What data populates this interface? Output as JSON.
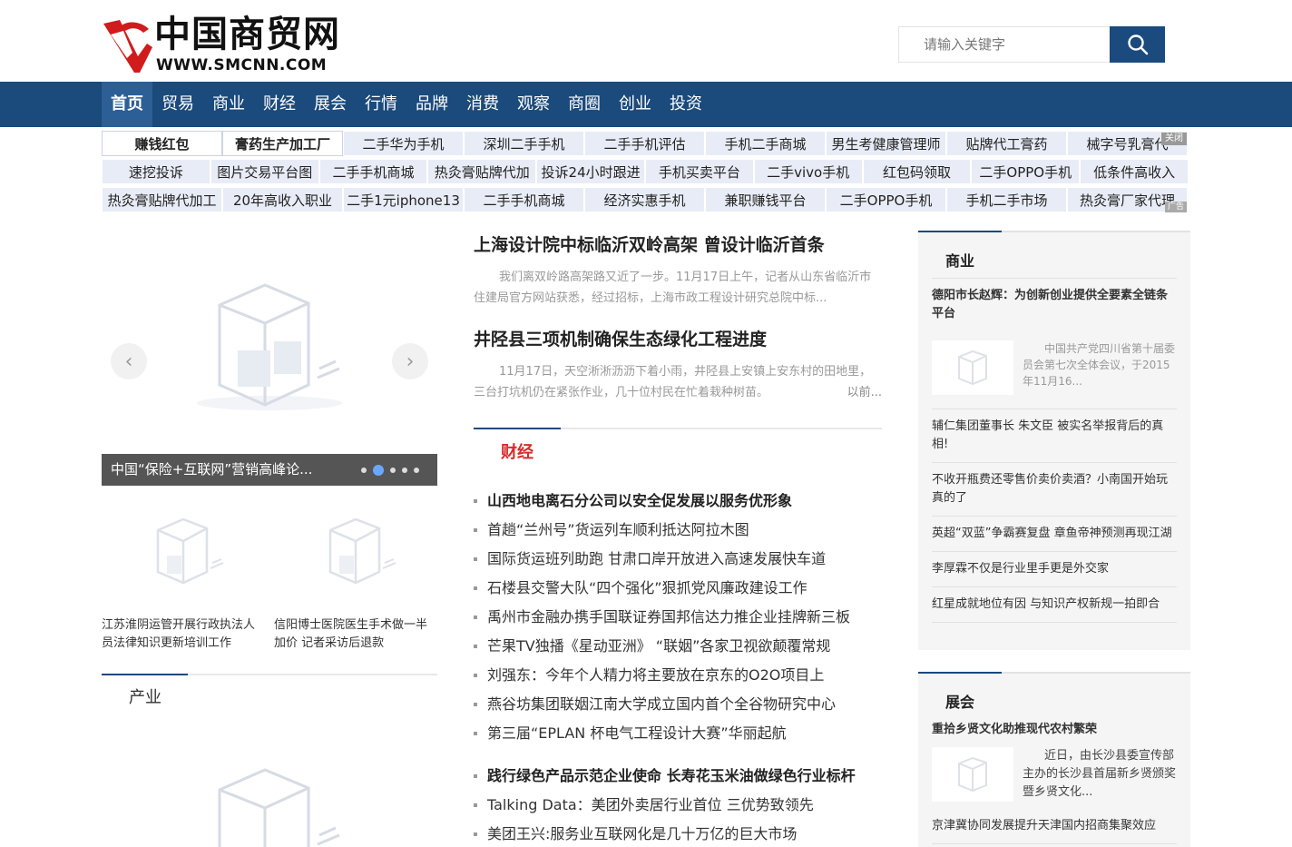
{
  "header": {
    "logo_cn": "中国商贸网",
    "logo_en": "WWW.SMCNN.COM",
    "search_placeholder": "请输入关键字"
  },
  "nav": [
    "首页",
    "贸易",
    "商业",
    "财经",
    "展会",
    "行情",
    "品牌",
    "消费",
    "观察",
    "商圈",
    "创业",
    "投资"
  ],
  "keywords": {
    "row1": [
      "赚钱红包",
      "膏药生产加工厂",
      "二手华为手机",
      "深圳二手手机",
      "二手手机评估",
      "手机二手商城",
      "男生考健康管理师",
      "贴牌代工膏药",
      "械字号乳膏代"
    ],
    "row2": [
      "速挖投诉",
      "图片交易平台图",
      "二手手机商城",
      "热灸膏贴牌代加",
      "投诉24小时跟进",
      "手机买卖平台",
      "二手vivo手机",
      "红包码领取",
      "二手OPPO手机",
      "低条件高收入"
    ],
    "row3": [
      "热灸膏贴牌代加工",
      "20年高收入职业",
      "二手1元iphone13",
      "二手手机商城",
      "经济实惠手机",
      "兼职赚钱平台",
      "二手OPPO手机",
      "手机二手市场",
      "热灸膏厂家代理"
    ],
    "close_label": "关闭",
    "ad_label": "广告"
  },
  "slider": {
    "caption": "中国“保险+互联网”营销高峰论...",
    "dot_count": 5,
    "active_dot": 1
  },
  "thumbs": [
    {
      "title": "江苏淮阴运管开展行政执法人员法律知识更新培训工作"
    },
    {
      "title": "信阳博士医院医生手术做一半加价 记者采访后退款"
    }
  ],
  "left_section": {
    "title": "产业"
  },
  "top_news": [
    {
      "title": "上海设计院中标临沂双岭高架 曾设计临沂首条",
      "summary": "我们离双岭路高架路又近了一步。11月17日上午，记者从山东省临沂市住建局官方网站获悉，经过招标，上海市政工程设计研究总院中标..."
    },
    {
      "title": "井陉县三项机制确保生态绿化工程进度",
      "summary": "11月17日，天空淅淅沥沥下着小雨，井陉县上安镇上安东村的田地里，三台打坑机仍在紧张作业，几十位村民在忙着栽种树苗。",
      "more": "以前..."
    }
  ],
  "finance": {
    "title": "财经",
    "group1": [
      "山西地电离石分公司以安全促发展以服务优形象",
      "首趟“兰州号”货运列车顺利抵达阿拉木图",
      "国际货运班列助跑 甘肃口岸开放进入高速发展快车道",
      "石楼县交警大队“四个强化”狠抓党风廉政建设工作",
      "禹州市金融办携手国联证券国邦信达力推企业挂牌新三板",
      "芒果TV独播《星动亚洲》 “联姻”各家卫视欲颠覆常规",
      "刘强东：今年个人精力将主要放在京东的O2O项目上",
      "燕谷坊集团联姻江南大学成立国内首个全谷物研究中心",
      "第三届“EPLAN 杯电气工程设计大赛”华丽起航"
    ],
    "group2": [
      "践行绿色产品示范企业使命 长寿花玉米油做绿色行业标杆",
      "Talking Data：美团外卖居行业首位 三优势致领先",
      "美团王兴:服务业互联网化是几十万亿的巨大市场"
    ]
  },
  "commerce": {
    "title": "商业",
    "lead": "德阳市长赵辉：为创新创业提供全要素全链条平台",
    "feature_text": "中国共产党四川省第十届委员会第七次全体会议，于2015年11月16...",
    "items": [
      "辅仁集团董事长 朱文臣 被实名举报背后的真相!",
      "不收开瓶费还零售价卖价卖酒？小南国开始玩真的了",
      "英超“双蓝”争霸赛复盘 章鱼帝神预测再现江湖",
      "李厚霖不仅是行业里手更是外交家",
      "红星成就地位有因 与知识产权新规一拍即合"
    ]
  },
  "expo": {
    "title": "展会",
    "lead": "重拾乡贤文化助推现代农村繁荣",
    "feature_text": "近日，由长沙县委宣传部主办的长沙县首届新乡贤颁奖暨乡贤文化...",
    "items": [
      "京津冀协同发展提升天津国内招商集聚效应"
    ]
  }
}
